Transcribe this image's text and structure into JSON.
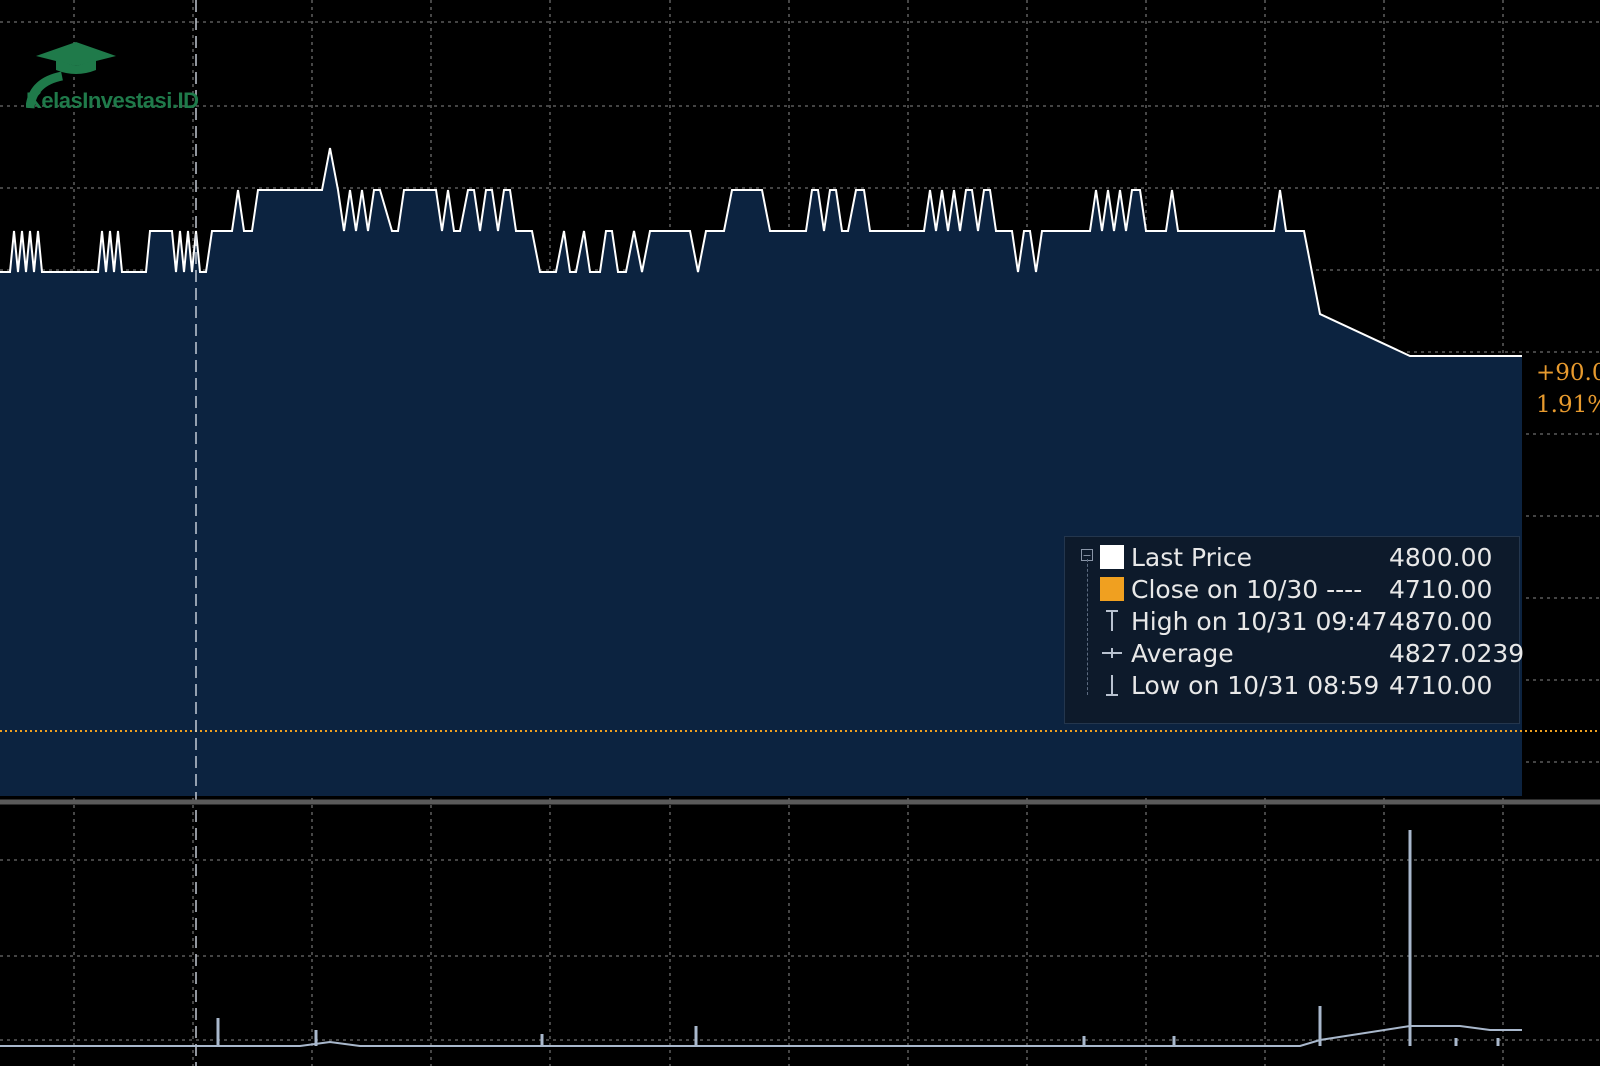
{
  "logo": {
    "text": "KelasInvestasi.ID",
    "icon": "graduation-cap-icon",
    "color": "#1f7a4a"
  },
  "colors": {
    "background": "#000000",
    "area_fill": "#0c2340",
    "price_line": "#ffffff",
    "close_line": "#f0a020",
    "volume": "#a9b8cc",
    "grid": "#6d6d6d",
    "change_text": "#e79a2e"
  },
  "change": {
    "points": "+90.0",
    "percent": "1.91%"
  },
  "legend": {
    "items": [
      {
        "label": "Last Price",
        "value": "4800.00",
        "symbol": "white-square"
      },
      {
        "label": "Close on 10/30 ----",
        "value": "4710.00",
        "symbol": "orange-square"
      },
      {
        "label": "High on 10/31 09:47",
        "value": "4870.00",
        "symbol": "high-marker-icon"
      },
      {
        "label": "Average",
        "value": "4827.0239",
        "symbol": "average-marker-icon"
      },
      {
        "label": "Low on 10/31 08:59",
        "value": "4710.00",
        "symbol": "low-marker-icon"
      }
    ]
  },
  "chart_data": {
    "type": "area",
    "ylim": [
      4670,
      4890
    ],
    "grid": true,
    "close_reference": 4710,
    "price": {
      "name": "Last Price",
      "x": [
        0,
        12,
        16,
        20,
        24,
        28,
        32,
        36,
        40,
        48,
        70,
        74,
        78,
        82,
        86,
        90,
        94,
        96,
        100,
        104,
        108,
        112,
        116,
        120,
        124,
        128,
        132,
        136,
        140,
        144,
        148,
        156,
        160,
        164,
        168,
        172,
        176,
        180,
        184,
        188,
        202,
        206,
        210,
        214,
        218,
        222,
        226,
        230,
        234,
        238,
        242,
        246,
        250,
        260,
        262,
        266,
        270,
        274,
        278,
        282,
        286,
        290,
        294,
        298,
        302,
        306,
        310,
        314,
        318,
        322,
        326,
        330,
        334,
        338,
        342,
        346,
        350,
        354,
        358,
        362,
        366,
        370,
        374,
        378,
        382,
        386,
        390,
        394,
        398,
        402,
        406,
        410,
        414,
        418,
        422,
        426,
        430,
        434,
        438,
        442,
        446,
        450,
        454,
        458,
        462,
        466,
        470,
        474,
        478,
        482,
        486,
        490,
        494,
        498,
        502,
        506,
        510,
        514,
        518,
        522,
        526,
        530,
        534,
        538,
        542,
        546,
        550,
        554,
        558,
        562,
        566,
        570,
        574,
        578,
        582,
        586,
        590,
        594,
        598,
        602,
        606,
        610,
        614,
        618,
        622,
        626,
        630,
        634,
        638,
        642,
        646,
        650,
        654,
        658,
        662,
        666,
        670,
        674,
        678,
        682,
        686,
        690,
        694,
        698,
        702,
        706,
        710,
        714,
        718,
        722,
        726,
        730,
        734,
        738,
        742,
        746,
        750,
        754,
        758,
        762,
        766,
        770,
        774,
        778,
        782,
        786,
        790,
        794,
        798,
        802,
        806,
        810,
        814,
        818,
        822,
        826,
        830,
        834,
        838,
        842,
        846,
        850,
        854,
        858,
        862,
        866,
        870,
        874,
        878,
        882,
        886,
        890,
        894,
        898,
        902,
        906,
        910,
        914,
        918,
        922,
        926,
        930,
        934,
        938,
        942,
        946,
        950,
        954,
        958,
        962,
        966,
        970,
        974,
        978,
        982,
        986,
        990,
        994,
        998,
        1002,
        1006,
        1010,
        1014,
        1018,
        1022,
        1026,
        1030,
        1034,
        1038,
        1042,
        1046,
        1050,
        1054,
        1058,
        1062,
        1066,
        1070,
        1074,
        1078,
        1082,
        1086,
        1090,
        1094,
        1098,
        1102,
        1106,
        1110,
        1114,
        1118,
        1122,
        1126,
        1130,
        1134,
        1138,
        1142,
        1146,
        1150,
        1154,
        1158,
        1162,
        1166,
        1170,
        1174,
        1178,
        1182,
        1186,
        1190,
        1194,
        1198,
        1202,
        1206,
        1210,
        1214,
        1218,
        1222,
        1226,
        1230,
        1234,
        1238,
        1242,
        1246,
        1250,
        1254,
        1258,
        1262,
        1266,
        1270,
        1274,
        1278,
        1282,
        1286,
        1290,
        1294,
        1298,
        1302,
        1306,
        1310,
        1314,
        1318,
        1322,
        1326,
        1330,
        1334,
        1338,
        1342,
        1346,
        1350,
        1354,
        1358,
        1362,
        1366,
        1370,
        1374,
        1378,
        1382,
        1386,
        1390,
        1394,
        1398,
        1402,
        1406,
        1410,
        1414,
        1418,
        1422,
        1426,
        1430,
        1434,
        1438,
        1442,
        1446,
        1450,
        1454,
        1458,
        1462,
        1466,
        1470,
        1474,
        1478,
        1482,
        1486,
        1490,
        1494,
        1498,
        1502,
        1506,
        1510,
        1514,
        1518,
        1522
      ],
      "values": []
    },
    "volume_spikes": [
      {
        "x": 218,
        "v": 28
      },
      {
        "x": 316,
        "v": 16
      },
      {
        "x": 542,
        "v": 12
      },
      {
        "x": 696,
        "v": 20
      },
      {
        "x": 1084,
        "v": 10
      },
      {
        "x": 1174,
        "v": 10
      },
      {
        "x": 1320,
        "v": 40
      },
      {
        "x": 1410,
        "v": 216
      },
      {
        "x": 1456,
        "v": 8
      },
      {
        "x": 1498,
        "v": 8
      }
    ]
  }
}
